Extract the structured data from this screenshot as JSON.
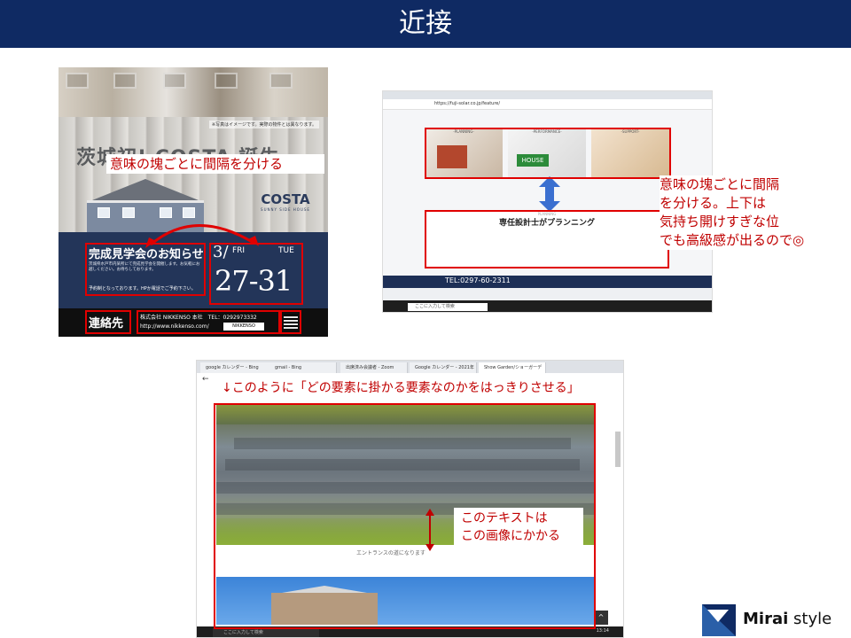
{
  "slide": {
    "title": "近接"
  },
  "panel1": {
    "brand_partial": "茨城初! COSTA 誕生",
    "photo_note": "※写真はイメージです。実際の物件とは異なります。",
    "callout": "意味の塊ごとに間隔を分ける",
    "brand_name": "COSTA",
    "brand_sub": "SUNNY SIDE HOUSE",
    "event_title": "完成見学会のお知らせ",
    "event_body": "茨城県水戸市内某所にて完成見学会を開催します。お気軽にお越しください。お待ちしております。",
    "event_foot": "予約制となっております。HPか電話でご予約下さい。",
    "date_month": "3/",
    "date_day_start": "FRI",
    "date_day_end": "TUE",
    "date_range": "27-31",
    "contact_label": "連絡先",
    "company": "株式会社 NIKKENSO 本社　TEL：0292973332",
    "company_url": "http://www.nikkenso.com/",
    "company_search": "NIKKENSO"
  },
  "panel2": {
    "url": "https://fuji-solar.co.jp/feature/",
    "thumb_labels": [
      "-PLANNING-",
      "-PERFORMANCE-",
      "-SUPPORT-"
    ],
    "thumb_house": "HOUSE",
    "section_title": "専任設計士がプランニング",
    "section_sub": "PLANNING",
    "phone": "TEL:0297-60-2311",
    "search_placeholder": "ここに入力して検索",
    "note": [
      "意味の塊ごとに間隔",
      "を分ける。上下は",
      "気持ち開けすぎな位",
      "でも高級感が出るので◎"
    ]
  },
  "panel3": {
    "tabs": [
      "google カレンダー - Bing",
      "gmail - Bing",
      "出席済み会議者 - Zoom",
      "Google カレンダー - 2021年",
      "Show Garden/ショーガーデ"
    ],
    "caption": "エントランスの道になります",
    "search_placeholder": "ここに入力して検索",
    "time": "13:14",
    "note_top": "↓このように「どの要素に掛かる要素なのかをはっきりさせる」",
    "note_box": [
      "このテキストは",
      "この画像にかかる"
    ]
  },
  "logo": {
    "name_bold": "Mirai",
    "name_light": " style"
  },
  "colors": {
    "header": "#0f2a63",
    "accent_red": "#c00000",
    "box_red": "#e00000",
    "arrow_blue": "#3a6fd0"
  }
}
